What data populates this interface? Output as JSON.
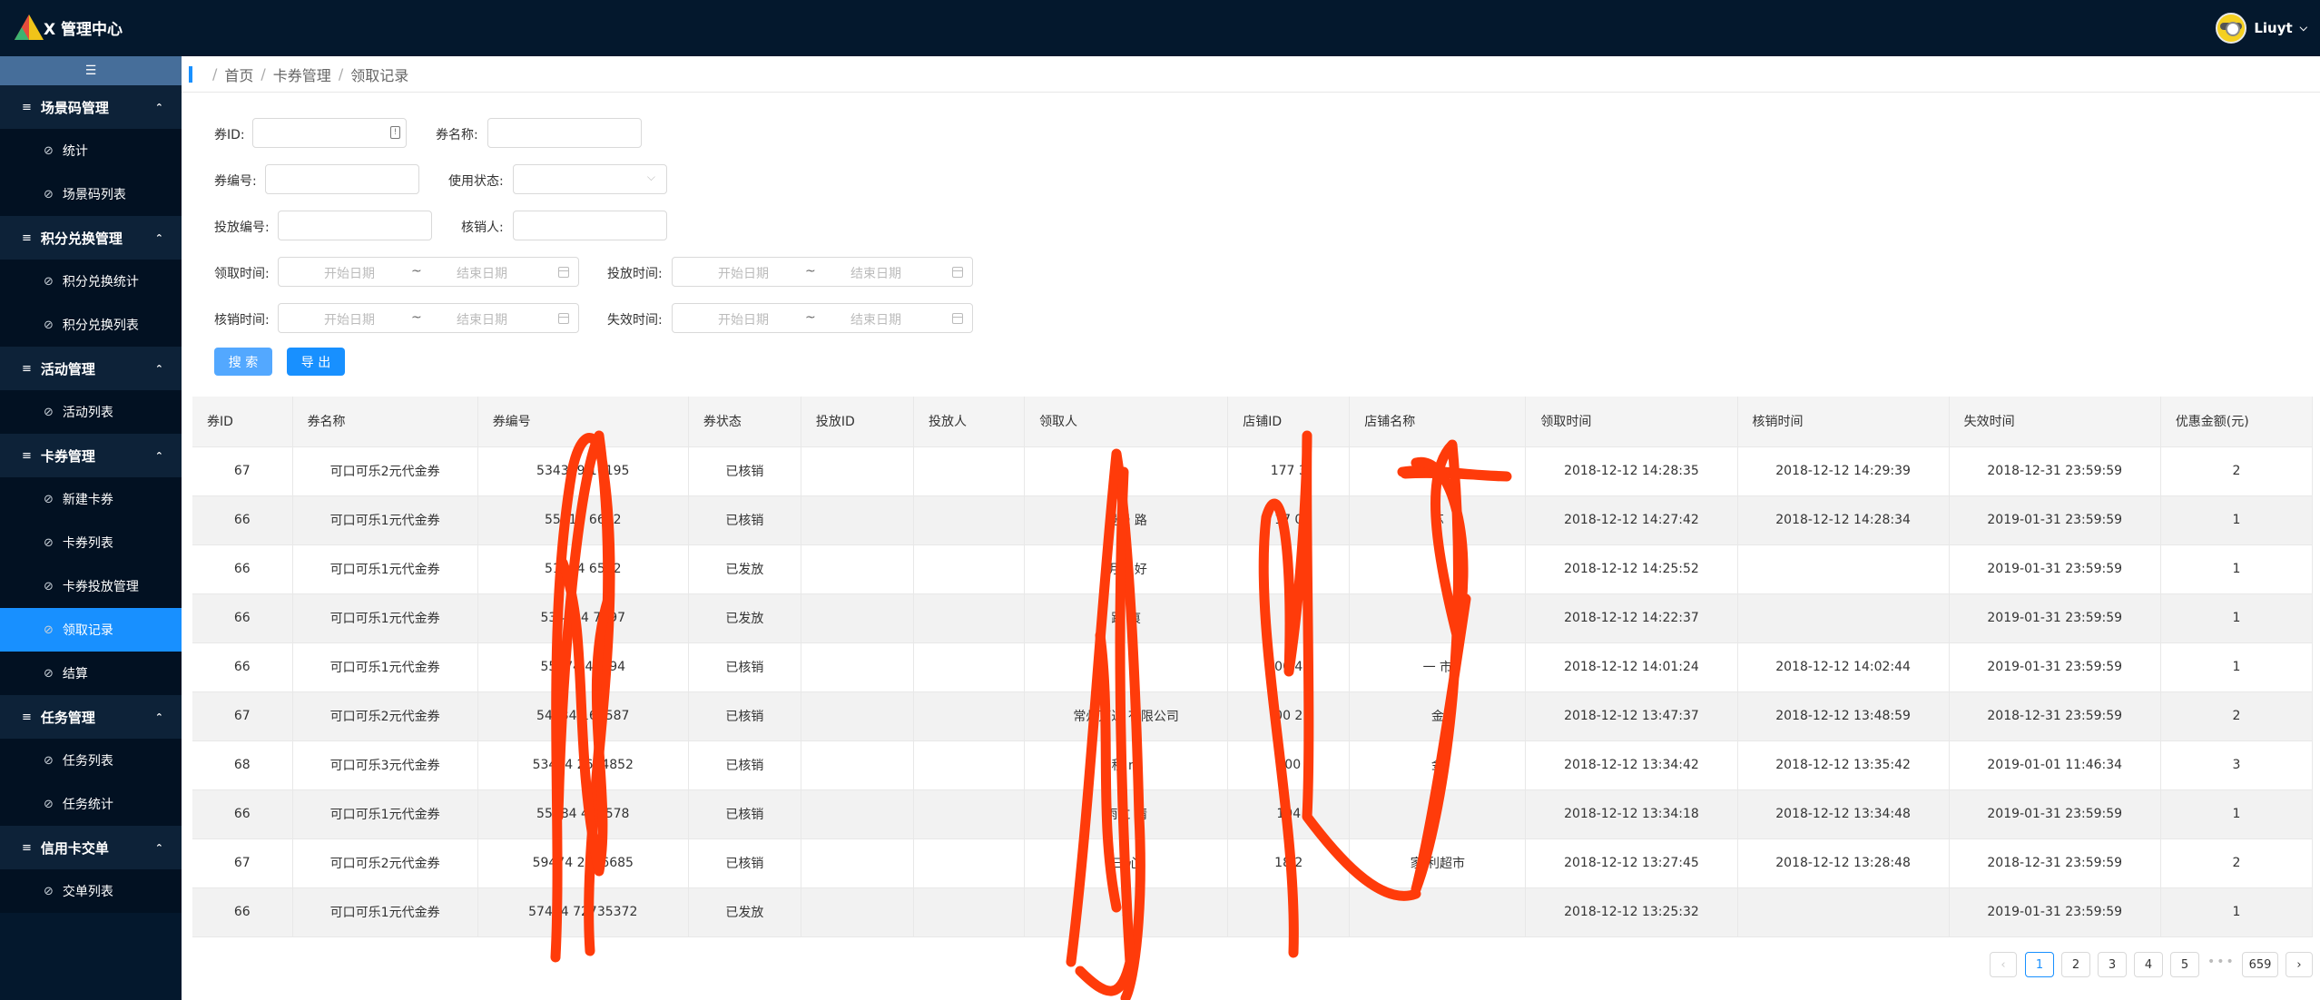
{
  "header": {
    "app_title": "X 管理中心",
    "username": "Liuyt",
    "user_caret": "⌵"
  },
  "sidebar": {
    "collapse_icon": "☰",
    "groups": [
      {
        "label": "场景码管理",
        "items": [
          "统计",
          "场景码列表"
        ]
      },
      {
        "label": "积分兑换管理",
        "items": [
          "积分兑换统计",
          "积分兑换列表"
        ]
      },
      {
        "label": "活动管理",
        "items": [
          "活动列表"
        ]
      },
      {
        "label": "卡券管理",
        "items": [
          "新建卡券",
          "卡券列表",
          "卡券投放管理",
          "领取记录",
          "结算"
        ]
      },
      {
        "label": "任务管理",
        "items": [
          "任务列表",
          "任务统计"
        ]
      },
      {
        "label": "信用卡交单",
        "items": [
          "交单列表"
        ]
      }
    ],
    "group_icon": "≡",
    "item_icon": "⊘",
    "group_arrow": "⌃",
    "active_item": "领取记录"
  },
  "breadcrumb": [
    "首页",
    "卡券管理",
    "领取记录"
  ],
  "filters": {
    "coupon_id": "券ID:",
    "coupon_name": "券名称:",
    "coupon_no": "券编号:",
    "use_status": "使用状态:",
    "dispatch_no": "投放编号:",
    "verifier": "核销人:",
    "claim_time": "领取时间:",
    "dispatch_time": "投放时间:",
    "verify_time": "核销时间:",
    "expire_time": "失效时间:",
    "start_placeholder": "开始日期",
    "end_placeholder": "结束日期",
    "range_sep": "~"
  },
  "buttons": {
    "search": "搜 索",
    "export": "导 出"
  },
  "table": {
    "columns": [
      "券ID",
      "券名称",
      "券编号",
      "券状态",
      "投放ID",
      "投放人",
      "领取人",
      "店铺ID",
      "店铺名称",
      "领取时间",
      "核销时间",
      "失效时间",
      "优惠金额(元)"
    ],
    "rows": [
      [
        "67",
        "可口可乐2元代金券",
        "534349 16195",
        "已核销",
        "",
        "",
        "",
        "177 3",
        "缤",
        "2018-12-12 14:28:35",
        "2018-12-12 14:29:39",
        "2018-12-31 23:59:59",
        "2"
      ],
      [
        "66",
        "可口可乐1元代金券",
        "55414 6672",
        "已核销",
        "",
        "",
        "漫漫 路",
        "17 0",
        "苏",
        "2018-12-12 14:27:42",
        "2018-12-12 14:28:34",
        "2019-01-31 23:59:59",
        "1"
      ],
      [
        "66",
        "可口可乐1元代金券",
        "51474 6582",
        "已发放",
        "",
        "",
        "明天 好",
        "",
        "",
        "2018-12-12 14:25:52",
        "",
        "2019-01-31 23:59:59",
        "1"
      ],
      [
        "66",
        "可口可乐1元代金券",
        "534844 7597",
        "已发放",
        "",
        "",
        "踏 痕",
        "",
        "",
        "2018-12-12 14:22:37",
        "",
        "2019-01-31 23:59:59",
        "1"
      ],
      [
        "66",
        "可口可乐1元代金券",
        "55474 43894",
        "已核销",
        "",
        "",
        "",
        "00 4",
        "一 市",
        "2018-12-12 14:01:24",
        "2018-12-12 14:02:44",
        "2019-01-31 23:59:59",
        "1"
      ],
      [
        "67",
        "可口可乐2元代金券",
        "54434 162587",
        "已核销",
        "",
        "",
        "常州万达 有限公司",
        "00 2",
        "金",
        "2018-12-12 13:47:37",
        "2018-12-12 13:48:59",
        "2018-12-31 23:59:59",
        "2"
      ],
      [
        "68",
        "可口可乐3元代金券",
        "53404 2684852",
        "已核销",
        "",
        "",
        "程 m",
        "100",
        "金",
        "2018-12-12 13:34:42",
        "2018-12-12 13:35:42",
        "2019-01-01 11:46:34",
        "3"
      ],
      [
        "66",
        "可口可乐1元代金券",
        "55484 480578",
        "已核销",
        "",
        "",
        "雨过 晴",
        "104",
        "",
        "2018-12-12 13:34:18",
        "2018-12-12 13:34:48",
        "2019-01-31 23:59:59",
        "1"
      ],
      [
        "67",
        "可口可乐2元代金券",
        "59474 2946685",
        "已核销",
        "",
        "",
        "三 心",
        "18 2",
        "家 利超市",
        "2018-12-12 13:27:45",
        "2018-12-12 13:28:48",
        "2018-12-31 23:59:59",
        "2"
      ],
      [
        "66",
        "可口可乐1元代金券",
        "57404 72735372",
        "已发放",
        "",
        "",
        "X",
        "",
        "",
        "2018-12-12 13:25:32",
        "",
        "2019-01-31 23:59:59",
        "1"
      ]
    ]
  },
  "pagination": {
    "prev": "‹",
    "pages": [
      "1",
      "2",
      "3",
      "4",
      "5"
    ],
    "ellipsis": "•••",
    "last": "659",
    "next": "›",
    "current": "1"
  },
  "colors": {
    "accent": "#1890ff",
    "header_bg": "#04182d",
    "scribble": "#ff3b0a"
  }
}
